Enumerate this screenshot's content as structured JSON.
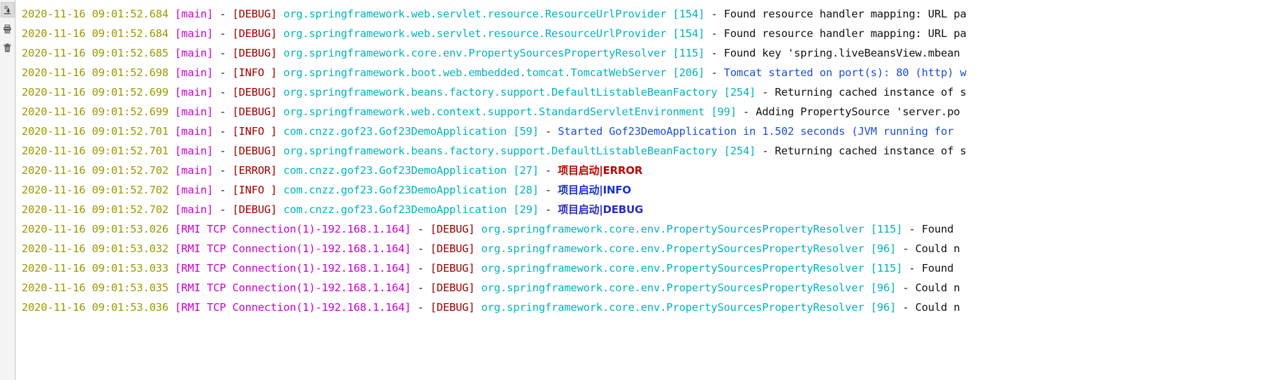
{
  "toolbar": {
    "buttons": [
      {
        "name": "export-icon",
        "label": "Export",
        "active": true
      },
      {
        "name": "print-icon",
        "label": "Print",
        "active": false
      },
      {
        "name": "delete-icon",
        "label": "Clear",
        "active": false
      }
    ]
  },
  "log": {
    "lines": [
      {
        "time": "2020-11-16 09:01:52.684",
        "thread": "[main]",
        "sep": " - ",
        "level": "[DEBUG]",
        "logger": "org.springframework.web.servlet.resource.ResourceUrlProvider",
        "lineno": "[154]",
        "dash": " - ",
        "message": "Found resource handler mapping: URL pa",
        "message_style": "plain"
      },
      {
        "time": "2020-11-16 09:01:52.684",
        "thread": "[main]",
        "sep": " - ",
        "level": "[DEBUG]",
        "logger": "org.springframework.web.servlet.resource.ResourceUrlProvider",
        "lineno": "[154]",
        "dash": " - ",
        "message": "Found resource handler mapping: URL pa",
        "message_style": "plain"
      },
      {
        "time": "2020-11-16 09:01:52.685",
        "thread": "[main]",
        "sep": " - ",
        "level": "[DEBUG]",
        "logger": "org.springframework.core.env.PropertySourcesPropertyResolver",
        "lineno": "[115]",
        "dash": " - ",
        "message": "Found key 'spring.liveBeansView.mbean",
        "message_style": "plain"
      },
      {
        "time": "2020-11-16 09:01:52.698",
        "thread": "[main]",
        "sep": " - ",
        "level": "[INFO ]",
        "logger": "org.springframework.boot.web.embedded.tomcat.TomcatWebServer",
        "lineno": "[206]",
        "dash": " - ",
        "message": "Tomcat started on port(s): 80 (http) w",
        "message_style": "blue"
      },
      {
        "time": "2020-11-16 09:01:52.699",
        "thread": "[main]",
        "sep": " - ",
        "level": "[DEBUG]",
        "logger": "org.springframework.beans.factory.support.DefaultListableBeanFactory",
        "lineno": "[254]",
        "dash": " - ",
        "message": "Returning cached instance of s",
        "message_style": "plain"
      },
      {
        "time": "2020-11-16 09:01:52.699",
        "thread": "[main]",
        "sep": " - ",
        "level": "[DEBUG]",
        "logger": "org.springframework.web.context.support.StandardServletEnvironment",
        "lineno": "[99]",
        "dash": " - ",
        "message": "Adding PropertySource 'server.po",
        "message_style": "plain"
      },
      {
        "time": "2020-11-16 09:01:52.701",
        "thread": "[main]",
        "sep": " - ",
        "level": "[INFO ]",
        "logger": "com.cnzz.gof23.Gof23DemoApplication",
        "lineno": "[59]",
        "dash": " - ",
        "message": "Started Gof23DemoApplication in 1.502 seconds (JVM running for ",
        "message_style": "blue"
      },
      {
        "time": "2020-11-16 09:01:52.701",
        "thread": "[main]",
        "sep": " - ",
        "level": "[DEBUG]",
        "logger": "org.springframework.beans.factory.support.DefaultListableBeanFactory",
        "lineno": "[254]",
        "dash": " - ",
        "message": "Returning cached instance of s",
        "message_style": "plain"
      },
      {
        "time": "2020-11-16 09:01:52.702",
        "thread": "[main]",
        "sep": " - ",
        "level": "[ERROR]",
        "logger": "com.cnzz.gof23.Gof23DemoApplication",
        "lineno": "[27]",
        "dash": " - ",
        "message": "项目启动|ERROR",
        "message_style": "red-bold"
      },
      {
        "time": "2020-11-16 09:01:52.702",
        "thread": "[main]",
        "sep": " - ",
        "level": "[INFO ]",
        "logger": "com.cnzz.gof23.Gof23DemoApplication",
        "lineno": "[28]",
        "dash": " - ",
        "message": "项目启动|INFO",
        "message_style": "cn-blue"
      },
      {
        "time": "2020-11-16 09:01:52.702",
        "thread": "[main]",
        "sep": " - ",
        "level": "[DEBUG]",
        "logger": "com.cnzz.gof23.Gof23DemoApplication",
        "lineno": "[29]",
        "dash": " - ",
        "message": "项目启动|DEBUG",
        "message_style": "cn-purple"
      },
      {
        "time": "2020-11-16 09:01:53.026",
        "thread": "[RMI TCP Connection(1)-192.168.1.164]",
        "sep": " - ",
        "level": "[DEBUG]",
        "logger": "org.springframework.core.env.PropertySourcesPropertyResolver",
        "lineno": "[115]",
        "dash": " - ",
        "message": "Found ",
        "message_style": "plain"
      },
      {
        "time": "2020-11-16 09:01:53.032",
        "thread": "[RMI TCP Connection(1)-192.168.1.164]",
        "sep": " - ",
        "level": "[DEBUG]",
        "logger": "org.springframework.core.env.PropertySourcesPropertyResolver",
        "lineno": "[96]",
        "dash": " - ",
        "message": "Could n",
        "message_style": "plain"
      },
      {
        "time": "2020-11-16 09:01:53.033",
        "thread": "[RMI TCP Connection(1)-192.168.1.164]",
        "sep": " - ",
        "level": "[DEBUG]",
        "logger": "org.springframework.core.env.PropertySourcesPropertyResolver",
        "lineno": "[115]",
        "dash": " - ",
        "message": "Found ",
        "message_style": "plain"
      },
      {
        "time": "2020-11-16 09:01:53.035",
        "thread": "[RMI TCP Connection(1)-192.168.1.164]",
        "sep": " - ",
        "level": "[DEBUG]",
        "logger": "org.springframework.core.env.PropertySourcesPropertyResolver",
        "lineno": "[96]",
        "dash": " - ",
        "message": "Could n",
        "message_style": "plain"
      },
      {
        "time": "2020-11-16 09:01:53.036",
        "thread": "[RMI TCP Connection(1)-192.168.1.164]",
        "sep": " - ",
        "level": "[DEBUG]",
        "logger": "org.springframework.core.env.PropertySourcesPropertyResolver",
        "lineno": "[96]",
        "dash": " - ",
        "message": "Could n",
        "message_style": "plain"
      }
    ]
  },
  "colors": {
    "timestamp": "#9a9a00",
    "thread": "#cc00cc",
    "level": "#a00000",
    "logger": "#00b5b8",
    "message": "#111111",
    "message_highlight": "#1a4ed8",
    "error": "#c00000",
    "toolbar_bg": "#f4f4f4",
    "background": "#ffffff"
  }
}
